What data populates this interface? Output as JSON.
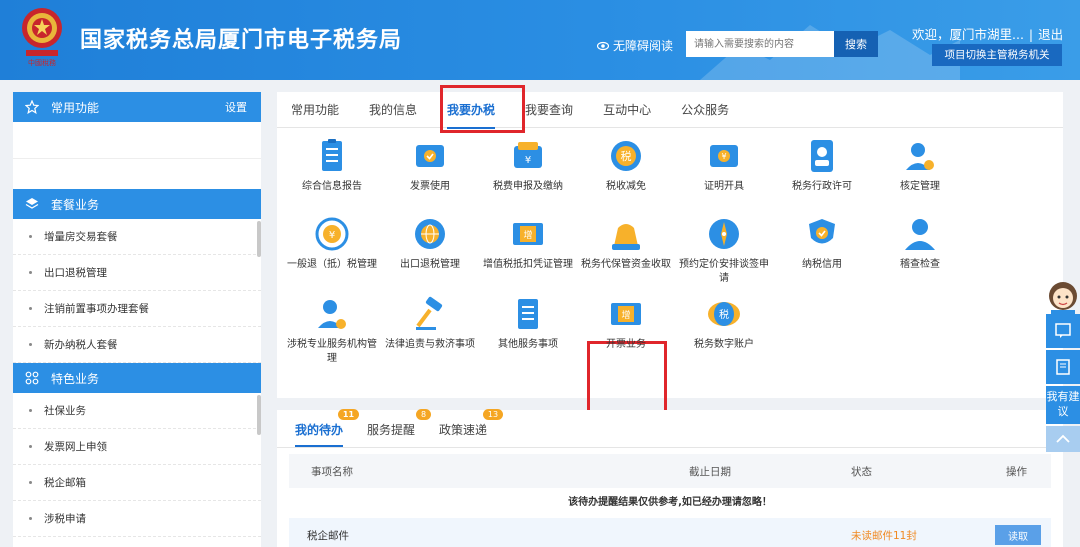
{
  "header": {
    "title": "国家税务总局厦门市电子税务局",
    "accessible_label": "无障碍阅读",
    "search_placeholder": "请输入需要搜索的内容",
    "search_button": "搜索",
    "welcome": "欢迎，厦门市湖里...",
    "logout": "退出",
    "switch_button": "项目切换主管税务机关"
  },
  "sidebar": {
    "common": {
      "label": "常用功能",
      "setting": "设置"
    },
    "package": {
      "label": "套餐业务",
      "items": [
        "增量房交易套餐",
        "出口退税管理",
        "注销前置事项办理套餐",
        "新办纳税人套餐"
      ]
    },
    "special": {
      "label": "特色业务",
      "items": [
        "社保业务",
        "发票网上申领",
        "税企邮箱",
        "涉税申请"
      ]
    }
  },
  "tabs": [
    "常用功能",
    "我的信息",
    "我要办税",
    "我要查询",
    "互动中心",
    "公众服务"
  ],
  "active_tab": "我要办税",
  "services": [
    {
      "label": "综合信息报告",
      "icon": "report-icon"
    },
    {
      "label": "发票使用",
      "icon": "invoice-icon"
    },
    {
      "label": "税费申报及缴纳",
      "icon": "wallet-icon"
    },
    {
      "label": "税收减免",
      "icon": "tax-relief-icon"
    },
    {
      "label": "证明开具",
      "icon": "certificate-icon"
    },
    {
      "label": "税务行政许可",
      "icon": "license-icon"
    },
    {
      "label": "核定管理",
      "icon": "user-gear-icon"
    },
    {
      "label": "一般退（抵）税管理",
      "icon": "refund-icon"
    },
    {
      "label": "出口退税管理",
      "icon": "globe-icon"
    },
    {
      "label": "增值税抵扣凭证管理",
      "icon": "vat-voucher-icon"
    },
    {
      "label": "税务代保管资金收取",
      "icon": "money-bag-icon"
    },
    {
      "label": "预约定价安排谈签申请",
      "icon": "compass-icon"
    },
    {
      "label": "纳税信用",
      "icon": "shield-check-icon"
    },
    {
      "label": "稽查检查",
      "icon": "inspector-icon"
    },
    {
      "label": "涉税专业服务机构管理",
      "icon": "agency-icon"
    },
    {
      "label": "法律追责与救济事项",
      "icon": "gavel-icon"
    },
    {
      "label": "其他服务事项",
      "icon": "list-icon"
    },
    {
      "label": "开票业务",
      "icon": "issue-invoice-icon"
    },
    {
      "label": "税务数字账户",
      "icon": "digital-account-icon"
    }
  ],
  "todo": {
    "tabs": [
      {
        "label": "我的待办",
        "count": "11"
      },
      {
        "label": "服务提醒",
        "count": "8"
      },
      {
        "label": "政策速递",
        "count": "13"
      }
    ],
    "columns": [
      "事项名称",
      "截止日期",
      "状态",
      "操作"
    ],
    "notice": "该待办提醒结果仅供参考,如已经办理请忽略！",
    "rows": [
      {
        "name": "税企邮件",
        "deadline": "",
        "status": "未读邮件11封",
        "action": "读取"
      }
    ]
  },
  "float": {
    "suggest_label": "我有建议"
  },
  "colors": {
    "primary": "#2c8fe4",
    "highlight": "#e0262b",
    "status": "#f08a24"
  }
}
